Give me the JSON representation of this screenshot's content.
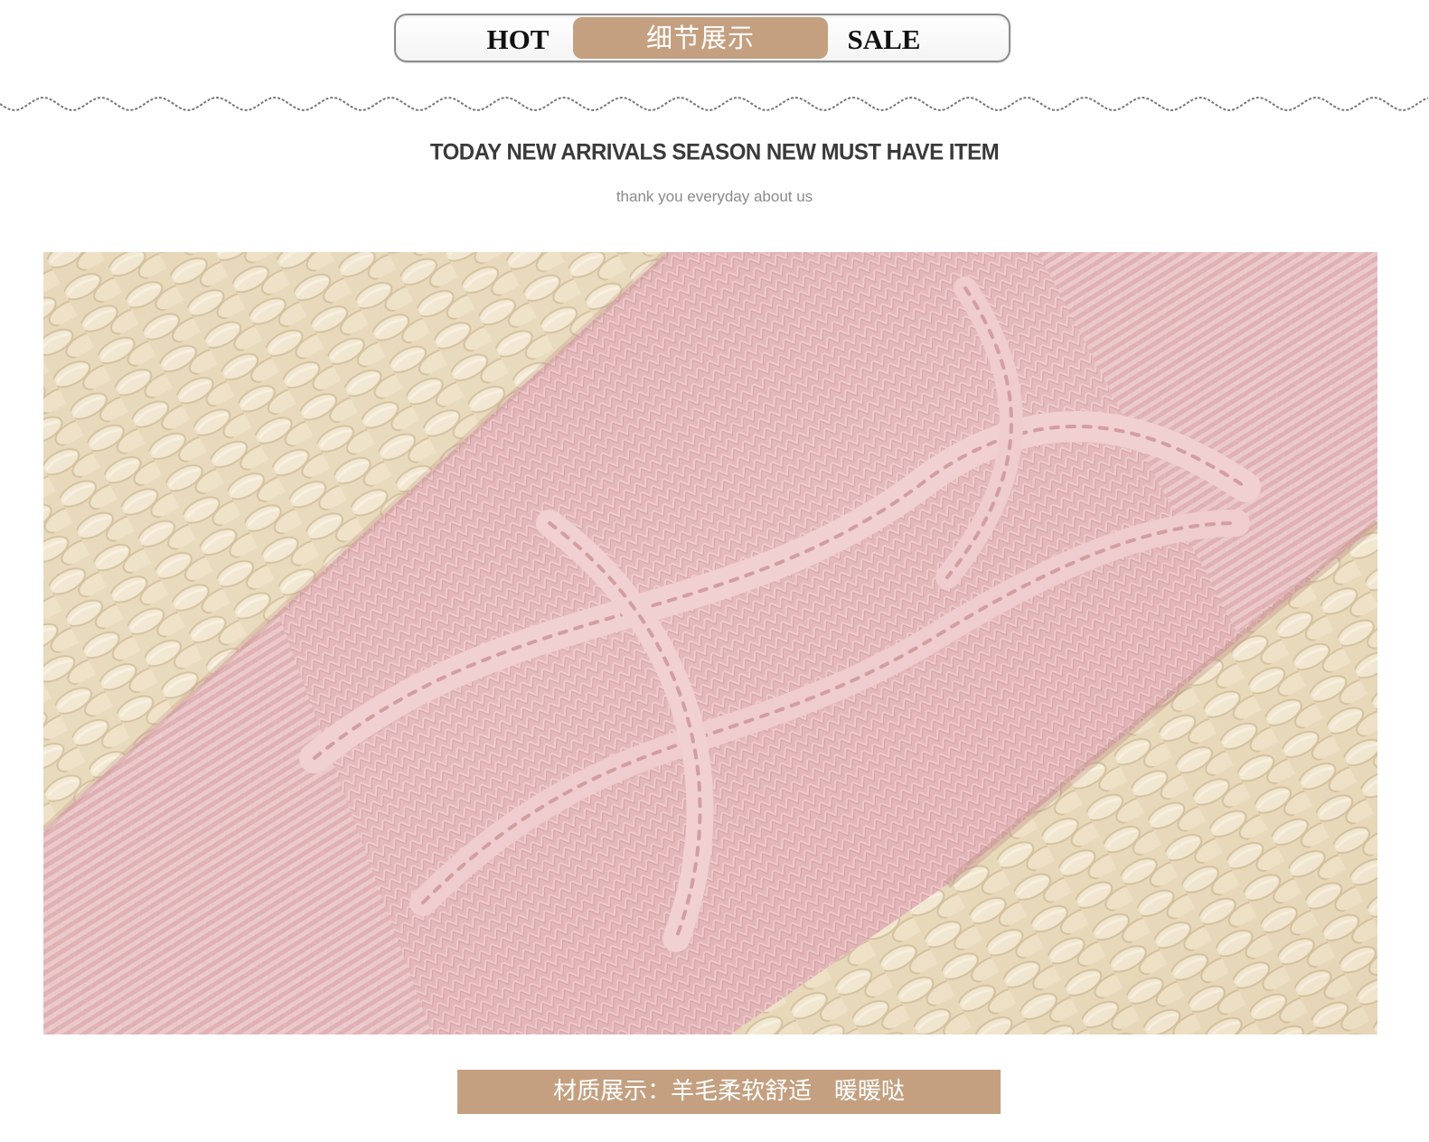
{
  "header": {
    "left_label": "HOT",
    "center_label": "细节展示",
    "right_label": "SALE"
  },
  "tagline": {
    "headline": "TODAY NEW ARRIVALS  SEASON NEW MUST HAVE ITEM",
    "subline": "thank you everyday about us"
  },
  "photo": {
    "subject": "pink cable-knit wool glove on woven straw",
    "colors": {
      "knit": "#e7bdbf",
      "straw": "#eee0c6"
    }
  },
  "caption": {
    "text": "材质展示：羊毛柔软舒适   暖暖哒"
  },
  "colors": {
    "accent": "#c4a080"
  }
}
